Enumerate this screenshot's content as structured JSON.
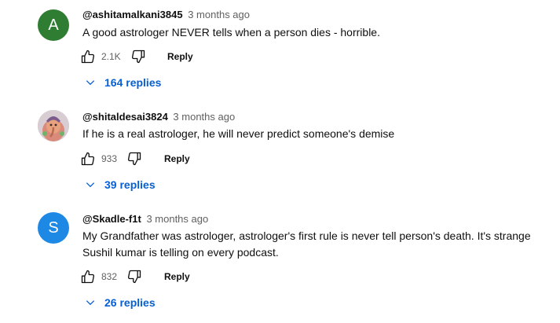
{
  "comments": [
    {
      "author": "@ashitamalkani3845",
      "time": "3 months ago",
      "avatar_letter": "A",
      "avatar_color": "#2e7d32",
      "text": "A good astrologer NEVER tells when a person dies - horrible.",
      "likes": "2.1K",
      "reply_label": "Reply",
      "replies_label": "164 replies"
    },
    {
      "author": "@shitaldesai3824",
      "time": "3 months ago",
      "avatar_letter": "",
      "avatar_color": "#c9bfc7",
      "text": "If he is a real astrologer, he will never predict someone's demise",
      "likes": "933",
      "reply_label": "Reply",
      "replies_label": "39 replies"
    },
    {
      "author": "@Skadle-f1t",
      "time": "3 months ago",
      "avatar_letter": "S",
      "avatar_color": "#1e88e5",
      "text": "My Grandfather was astrologer, astrologer's first rule is never tell person's death. It's strange Sushil kumar is telling on every podcast.",
      "likes": "832",
      "reply_label": "Reply",
      "replies_label": "26 replies"
    }
  ],
  "icons": {
    "like": "thumbs-up-icon",
    "dislike": "thumbs-down-icon",
    "expand": "chevron-down-icon"
  },
  "colors": {
    "link": "#065fd4",
    "secondary_text": "#606060"
  }
}
